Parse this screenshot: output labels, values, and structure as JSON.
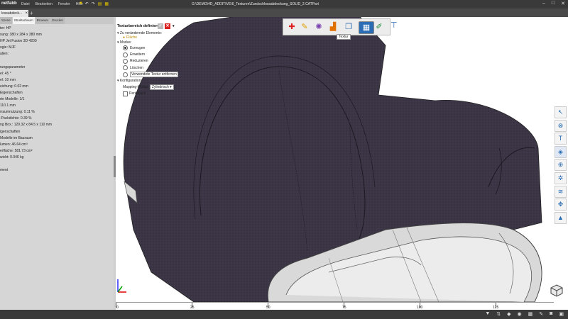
{
  "app": {
    "logo": "netfabb",
    "menu": [
      "Datei",
      "Bearbeiten",
      "Fenster",
      "Hilfe"
    ],
    "path": "G:\\DEMO\\4D_ADDITIVE\\6_Texturen\\Zundschlossabdeckung_SOLID_2.CATPart"
  },
  "doc_tab": {
    "label": "lossabdeck..."
  },
  "left_panel": {
    "tabs": [
      "Szene",
      "Strukturbaum",
      "Browser",
      "Drucker"
    ],
    "lines": [
      "ter: HP",
      "sung: 380 x 284 x 380 mm",
      "HP Jet Fusion 3D 4200",
      "ogie: MJF",
      "alien:",
      "",
      "rungsparameter",
      "el: 45 °",
      "el: 10 mm",
      "eichung: 0.02 mm",
      "Eigenschaften",
      "rte Modelle: 1/1",
      "110.1 mm",
      "rraumnutzung: 0.11 %",
      "-Packdichte: 0.39 %",
      "ng Box.: 129.32 x 84.5 x 110 mm",
      "igenschaften",
      "Modelle im Bauraum",
      "lumen: 46.64 cm³",
      "erfläche: 581.73 cm²",
      "wicht: 0.046 kg",
      "",
      "ment"
    ]
  },
  "texture_panel": {
    "title": "Texturbereich definieren",
    "ok": "✓",
    "cancel": "✕",
    "more": "▾",
    "section_elements": "Zu verändernde Elemente:",
    "element_face": "Fläche",
    "section_modus": "Modus:",
    "modes": [
      "Erzeugen",
      "Erweitern",
      "Reduzieren",
      "Löschen",
      "Verwendete Textur entfernen"
    ],
    "selected_mode": 0,
    "section_config": "Konfiguration:",
    "mapping_label": "Mapping-Modus",
    "mapping_value": "Zylindrisch",
    "periodic_label": "Periodisch"
  },
  "ribbon": {
    "tooltip": "Textur",
    "icons": [
      "add-icon",
      "brush-icon",
      "sparkle-icon",
      "bar-icon",
      "copy-icon",
      "texture-icon",
      "edit-icon",
      "stamp-icon"
    ]
  },
  "ruler": {
    "labels": [
      "0",
      "25",
      "50",
      "75",
      "100",
      "125"
    ]
  },
  "colors": {
    "surface": "#3b3545",
    "accent": "#2a6db4"
  }
}
